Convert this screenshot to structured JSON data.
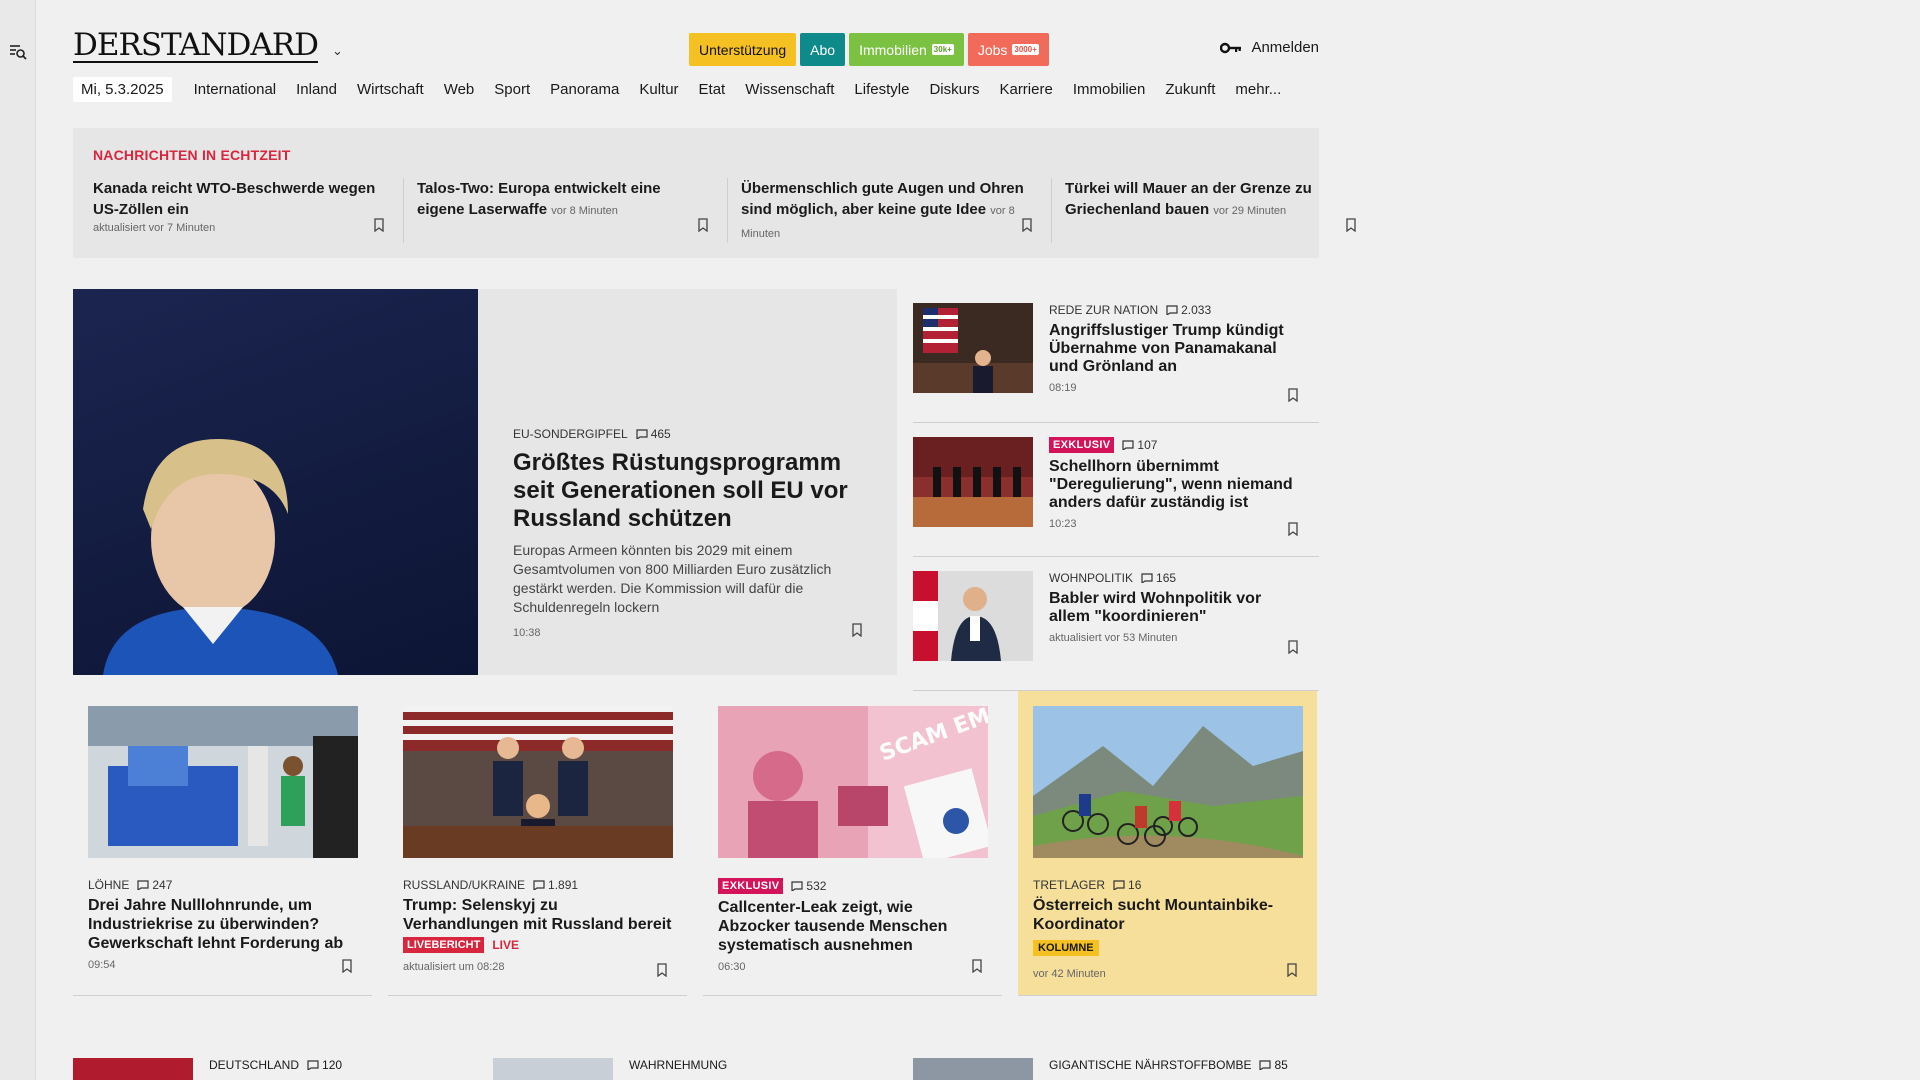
{
  "header": {
    "logo": "DERSTANDARD",
    "pills": {
      "support": "Unterstützung",
      "abo": "Abo",
      "immobilien": "Immobilien",
      "immobilien_badge": "30k+",
      "jobs": "Jobs",
      "jobs_badge": "3000+"
    },
    "login": "Anmelden"
  },
  "nav": {
    "date": "Mi, 5.3.2025",
    "items": [
      "International",
      "Inland",
      "Wirtschaft",
      "Web",
      "Sport",
      "Panorama",
      "Kultur",
      "Etat",
      "Wissenschaft",
      "Lifestyle",
      "Diskurs",
      "Karriere",
      "Immobilien",
      "Zukunft",
      "mehr..."
    ]
  },
  "ticker": {
    "label": "NACHRICHTEN IN ECHTZEIT",
    "items": [
      {
        "title": "Kanada reicht WTO-Beschwerde wegen US-Zöllen ein",
        "time": "aktualisiert vor 7 Minuten"
      },
      {
        "title": "Talos-Two: Europa entwickelt eine eigene Laserwaffe",
        "time": "vor 8 Minuten"
      },
      {
        "title": "Übermenschlich gute Augen und Ohren sind möglich, aber keine gute Idee",
        "time": "vor 8 Minuten"
      },
      {
        "title": "Türkei will Mauer an der Grenze zu Griechenland bauen",
        "time": "vor 29 Minuten"
      }
    ]
  },
  "lead": {
    "kicker": "EU-SONDERGIPFEL",
    "comments": "465",
    "title": "Größtes Rüstungsprogramm seit Generationen soll EU vor Russland schützen",
    "teaser": "Europas Armeen könnten bis 2029 mit einem Gesamtvolumen von 800 Milliarden Euro zusätzlich gestärkt werden. Die Kommission will dafür die Schuldenregeln lockern",
    "time": "10:38"
  },
  "side": [
    {
      "kicker": "REDE ZUR NATION",
      "comments": "2.033",
      "title": "Angriffslustiger Trump kündigt Übernahme von Panamakanal und Grönland an",
      "time": "08:19"
    },
    {
      "kicker": "EXKLUSIV",
      "comments": "107",
      "title": "Schellhorn übernimmt \"Deregulierung\", wenn niemand anders dafür zuständig ist",
      "time": "10:23"
    },
    {
      "kicker": "WOHNPOLITIK",
      "comments": "165",
      "title": "Babler wird Wohnpolitik vor allem \"koordinieren\"",
      "time": "aktualisiert vor 53 Minuten"
    }
  ],
  "cards": [
    {
      "kicker": "LÖHNE",
      "comments": "247",
      "title": "Drei Jahre Nulllohnrunde, um Industriekrise zu überwinden? Gewerkschaft lehnt Forderung ab",
      "time": "09:54"
    },
    {
      "kicker": "RUSSLAND/UKRAINE",
      "comments": "1.891",
      "title": "Trump: Selenskyj zu Verhandlungen mit Russland bereit",
      "live_label": "LIVEBERICHT",
      "live": "LIVE",
      "time": "aktualisiert um 08:28"
    },
    {
      "kicker": "EXKLUSIV",
      "comments": "532",
      "title": "Callcenter-Leak zeigt, wie Abzocker tausende Menschen systematisch ausnehmen",
      "time": "06:30",
      "img_text": "SCAM EMPIRE"
    },
    {
      "kicker": "TRETLAGER",
      "comments": "16",
      "title": "Österreich sucht Mountainbike-Koordinator",
      "tag": "KOLUMNE",
      "time": "vor 42 Minuten"
    }
  ],
  "bottom": [
    {
      "kicker": "DEUTSCHLAND",
      "comments": "120"
    },
    {
      "kicker": "WAHRNEHMUNG"
    },
    {
      "kicker": "GIGANTISCHE NÄHRSTOFFBOMBE",
      "comments": "85"
    }
  ],
  "colors": {
    "accent_red": "#d7263d",
    "exklusiv": "#d4145a",
    "support": "#f5c021",
    "abo": "#0f8a8a",
    "immobilien": "#7cc242",
    "jobs": "#f26a5a",
    "highlight_card": "#f5df9a"
  }
}
